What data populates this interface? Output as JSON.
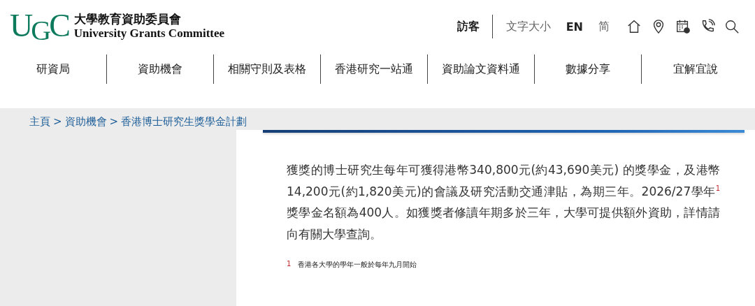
{
  "header": {
    "logo": "UGC",
    "name_zh": "大學教育資助委員會",
    "name_en": "University Grants Committee",
    "links": [
      {
        "kind": "account",
        "label": "訪客"
      },
      {
        "kind": "plain",
        "label": "文字大小"
      },
      {
        "kind": "bold",
        "label": "EN"
      },
      {
        "kind": "plain",
        "label": "简"
      }
    ]
  },
  "nav": [
    "研資局",
    "資助機會",
    "相關守則及表格",
    "香港研究一站通",
    "資助論文資料通",
    "數據分享",
    "宜解宜說"
  ],
  "breadcrumb": {
    "separator": ">",
    "items": [
      "主頁",
      "資助機會",
      "香港博士研究生獎學金計劃"
    ]
  },
  "article": {
    "paragraph": "獲獎的博士研究生每年可獲得港幣340,800元(約43,690美元) 的獎學金，及港幣14,200元(約1,820美元)的會議及研究活動交通津貼，為期三年。2026/27學年$^{1}$ 獎學金名額為400人。如獲獎者修讀年期多於三年，大學可提供額外資助，詳情請向有關大學查詢。",
    "footnotes": [
      {
        "mark": "1",
        "text": "香港各大學的學年一般於每年九月開始"
      }
    ]
  }
}
